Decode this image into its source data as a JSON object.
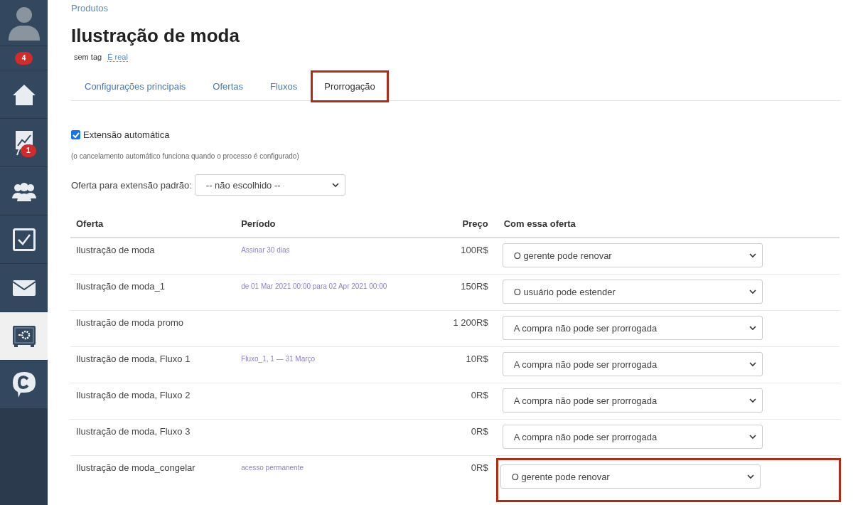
{
  "sidebar": {
    "items": [
      {
        "kind": "avatar",
        "selected": false
      },
      {
        "kind": "badge",
        "badge": "4",
        "selected": false
      },
      {
        "kind": "home",
        "selected": false
      },
      {
        "kind": "chart",
        "badge": "1",
        "selected": false
      },
      {
        "kind": "users",
        "selected": false
      },
      {
        "kind": "tasks",
        "selected": false
      },
      {
        "kind": "mail",
        "selected": false
      },
      {
        "kind": "safe",
        "selected": true
      },
      {
        "kind": "chat",
        "selected": false
      }
    ]
  },
  "breadcrumb": "Produtos",
  "title": "Ilustração de moda",
  "tags": {
    "label": "sem tag",
    "link": "É real"
  },
  "tabs": [
    {
      "label": "Configurações principais",
      "selected": false,
      "highlighted": false
    },
    {
      "label": "Ofertas",
      "selected": false,
      "highlighted": false
    },
    {
      "label": "Fluxos",
      "selected": false,
      "highlighted": false
    },
    {
      "label": "Prorrogação",
      "selected": true,
      "highlighted": true
    }
  ],
  "auto_extension": {
    "label": "Extensão automática",
    "checked": true
  },
  "note": "(o cancelamento automático funciona quando o processo é configurado)",
  "default_offer": {
    "label": "Oferta para extensão padrão:",
    "value": "-- não escolhido --"
  },
  "table": {
    "columns": [
      "Oferta",
      "Período",
      "Preço",
      "Com essa oferta"
    ],
    "rows": [
      {
        "offer": "Ilustração de moda",
        "period": "Assinar 30 dias",
        "price": "100R$",
        "option": "O gerente pode renovar",
        "highlighted": false
      },
      {
        "offer": "Ilustração de moda_1",
        "period": "de 01 Mar 2021 00:00 para 02 Apr 2021 00:00",
        "price": "150R$",
        "option": "O usuário pode estender",
        "highlighted": false
      },
      {
        "offer": "Ilustração de moda promo",
        "price": "1 200R$",
        "option": "A compra não pode ser prorrogada",
        "highlighted": false
      },
      {
        "offer": "Ilustração de moda, Fluxo 1",
        "period": "Fluxo_1, 1 — 31 Março",
        "price": "10R$",
        "option": "A compra não pode ser prorrogada",
        "highlighted": false
      },
      {
        "offer": "Ilustração de moda, Fluxo 2",
        "price": "0R$",
        "option": "A compra não pode ser prorrogada",
        "highlighted": false
      },
      {
        "offer": "Ilustração de moda, Fluxo 3",
        "price": "0R$",
        "option": "A compra não pode ser prorrogada",
        "highlighted": false
      },
      {
        "offer": "Ilustração de moda_congelar",
        "period": "acesso permanente",
        "price": "0R$",
        "option": "O gerente pode renovar",
        "highlighted": true
      }
    ]
  }
}
